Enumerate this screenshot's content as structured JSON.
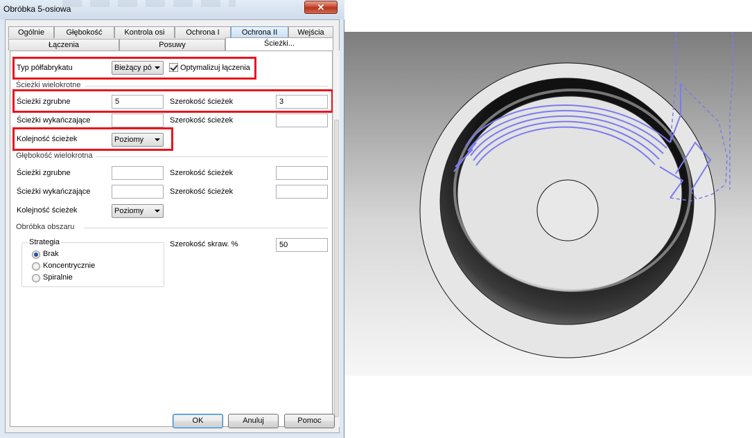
{
  "window": {
    "title": "Obróbka 5-osiowa",
    "close_glyph": "✕"
  },
  "tabs": {
    "row1": [
      "Ogólnie",
      "Głębokość",
      "Kontrola osi",
      "Ochrona I",
      "Ochrona II",
      "Wejścia"
    ],
    "row2": [
      "Łączenia",
      "Posuwy",
      "Ścieżki..."
    ]
  },
  "form": {
    "stock_type_label": "Typ półfabrykatu",
    "stock_type_value": "Bieżący pó",
    "optimize_links_label": "Optymalizuj łączenia",
    "optimize_links_checked": true,
    "multi_passes_title": "Ścieżki wielokrotne",
    "rough_passes_label": "Ścieżki zgrubne",
    "rough_passes_value": "5",
    "rough_width_label": "Szerokość ścieżek",
    "rough_width_value": "3",
    "finish_passes_label": "Ścieżki wykańczające",
    "finish_passes_value": "",
    "finish_width_label": "Szerokość ścieżek",
    "finish_width_value": "",
    "order_label": "Kolejność ścieżek",
    "order_value": "Poziomy",
    "multi_depth_title": "Głębokość wielokrotna",
    "depth_rough_label": "Ścieżki zgrubne",
    "depth_rough_value": "",
    "depth_rough_width_label": "Szerokość ścieżek",
    "depth_rough_width_value": "",
    "depth_finish_label": "Ścieżki wykańczające",
    "depth_finish_value": "",
    "depth_finish_width_label": "Szerokość ścieżek",
    "depth_finish_width_value": "",
    "depth_order_label": "Kolejność ścieżek",
    "depth_order_value": "Poziomy",
    "area_title": "Obróbka obszaru",
    "strategy_title": "Strategia",
    "strategy_options": [
      "Brak",
      "Koncentrycznie",
      "Spiralnie"
    ],
    "strategy_selected": "Brak",
    "cut_width_label": "Szerokość skraw. %",
    "cut_width_value": "50"
  },
  "buttons": {
    "ok": "OK",
    "cancel": "Anuluj",
    "help": "Pomoc"
  },
  "colors": {
    "highlight_box": "#e8151d",
    "toolpath": "#7b7bf0",
    "active_tab": "#c6def4"
  }
}
